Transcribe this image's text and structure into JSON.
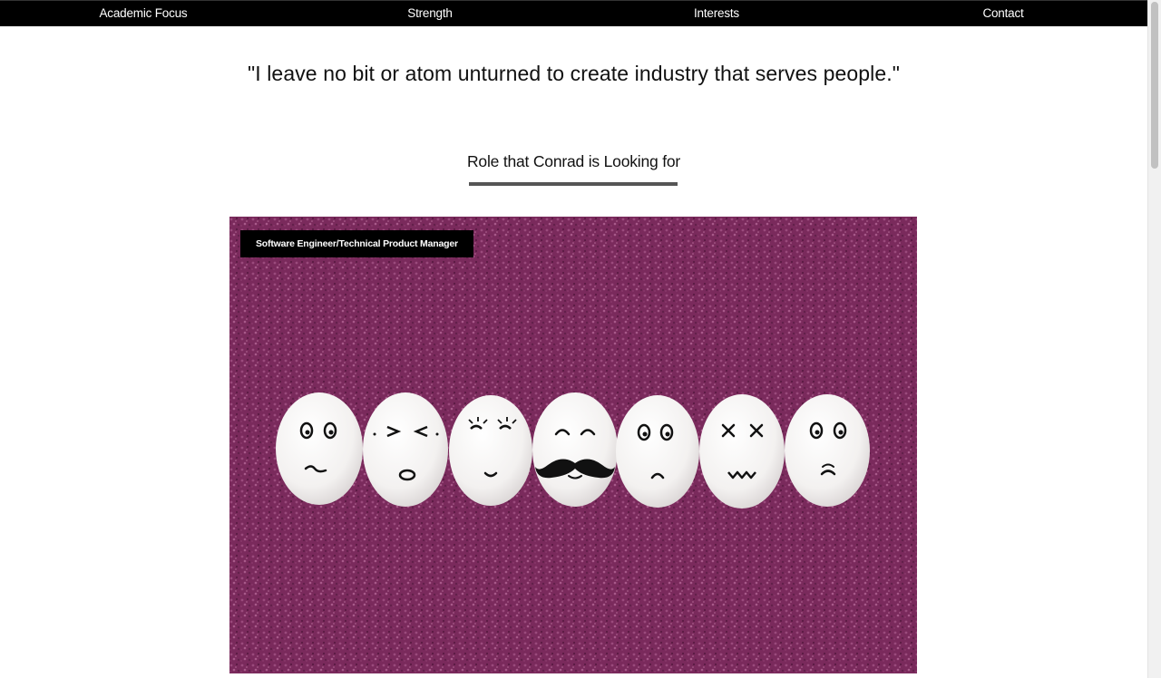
{
  "nav": {
    "items": [
      {
        "label": "Academic Focus"
      },
      {
        "label": "Strength"
      },
      {
        "label": "Interests"
      },
      {
        "label": "Contact"
      }
    ]
  },
  "quote": "\"I leave no bit or atom unturned to create industry that serves people.\"",
  "section": {
    "title": "Role that Conrad is Looking for",
    "role_badge": "Software Engineer/Technical Product Manager"
  },
  "colors": {
    "navbar": "#000000",
    "hero_background": "#7a2a5c",
    "underline": "#555555"
  }
}
